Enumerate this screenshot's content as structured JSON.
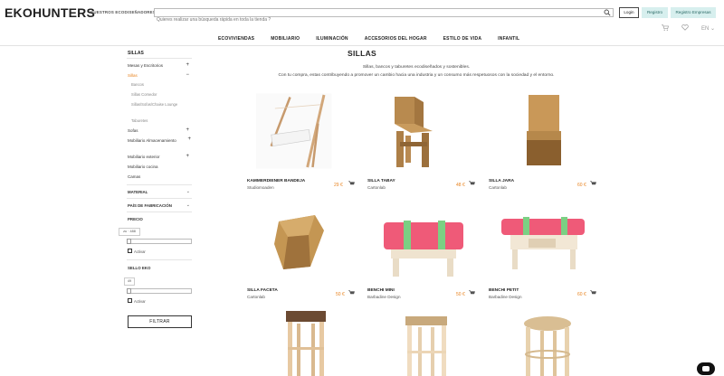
{
  "header": {
    "logo": "EKOHUNTERS",
    "tagline": "NUESTROS ECODISEÑADORES",
    "search_placeholder": "Quieres realizar una búsqueda rápida en toda la tienda ?",
    "login": "Login",
    "register": "Registro",
    "register_company": "Registro Empresas",
    "lang": "EN"
  },
  "nav": [
    "ECOVIVIENDAS",
    "MOBILIARIO",
    "ILUMINACIÓN",
    "ACCESORIOS DEL HOGAR",
    "ESTILO DE VIDA",
    "INFANTIL"
  ],
  "sidebar": {
    "title": "SILLAS",
    "categories": [
      {
        "label": "Mesas y Escritorios",
        "plus": "+"
      },
      {
        "label": "Sillas",
        "plus": "−"
      },
      {
        "label": "Bancos"
      },
      {
        "label": "Sillas Comedor"
      },
      {
        "label": "Sillas/Sofas/Chaise Lounge"
      },
      {
        "label": "Taburetes"
      },
      {
        "label": "Sofas",
        "plus": "+"
      },
      {
        "label": "Mobiliario Almacenamiento",
        "plus": "+"
      },
      {
        "label": "Mobiliario exterior",
        "plus": "+"
      },
      {
        "label": "Mobiliario cocina"
      },
      {
        "label": "Camas"
      }
    ],
    "filters": {
      "material": "MATERIAL",
      "pais": "PAÍS DE FABRICACIÓN",
      "precio": "PRECIO",
      "precio_range": "zu · 488",
      "activar": "Activar",
      "sello": "SELLO EKO",
      "sello_range": "49",
      "activar2": "Activar",
      "button": "FILTRAR"
    }
  },
  "main": {
    "title": "SILLAS",
    "desc_line1": "Sillas, bancos y taburetes ecodiseñados y sostenibles.",
    "desc_line2": "Con tu compra, estas contribuyendo a promover un cambio hacia una industria y un consumo más respetuosos con la sociedad y el entorno."
  },
  "products": [
    {
      "name": "KAMMERDIENER BANDEJA",
      "brand": "Studiomoaden",
      "price": "29 €"
    },
    {
      "name": "SILLA TABAY",
      "brand": "Cartonlab",
      "price": "48 €"
    },
    {
      "name": "SILLA JARA",
      "brand": "Cartonlab",
      "price": "60 €"
    },
    {
      "name": "SILLA FACETA",
      "brand": "Cartonlab",
      "price": "50 €"
    },
    {
      "name": "BENCHI MINI",
      "brand": "Barbadine Design",
      "price": "50 €"
    },
    {
      "name": "BENCHI PETIT",
      "brand": "Barbadine Design",
      "price": "60 €"
    }
  ]
}
